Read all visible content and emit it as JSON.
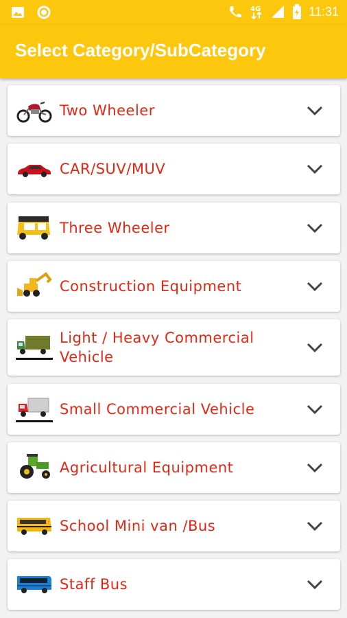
{
  "status": {
    "time": "11:31",
    "left_icons": [
      "image-icon",
      "circle-icon"
    ],
    "right_icons": [
      "call-icon",
      "4g-icon",
      "signal-icon",
      "battery-icon"
    ]
  },
  "appbar": {
    "title": "Select Category/SubCategory"
  },
  "categories": [
    {
      "label": "Two Wheeler",
      "icon": "motorcycle-icon"
    },
    {
      "label": "CAR/SUV/MUV",
      "icon": "car-icon"
    },
    {
      "label": "Three Wheeler",
      "icon": "auto-rickshaw-icon"
    },
    {
      "label": "Construction Equipment",
      "icon": "backhoe-loader-icon"
    },
    {
      "label": "Light / Heavy Commercial Vehicle",
      "icon": "truck-icon"
    },
    {
      "label": "Small Commercial Vehicle",
      "icon": "small-truck-icon"
    },
    {
      "label": "Agricultural Equipment",
      "icon": "tractor-icon"
    },
    {
      "label": "School Mini van /Bus",
      "icon": "school-bus-icon"
    },
    {
      "label": "Staff Bus",
      "icon": "staff-bus-icon"
    }
  ],
  "colors": {
    "accent": "#fdc70e",
    "label": "#e52613"
  }
}
